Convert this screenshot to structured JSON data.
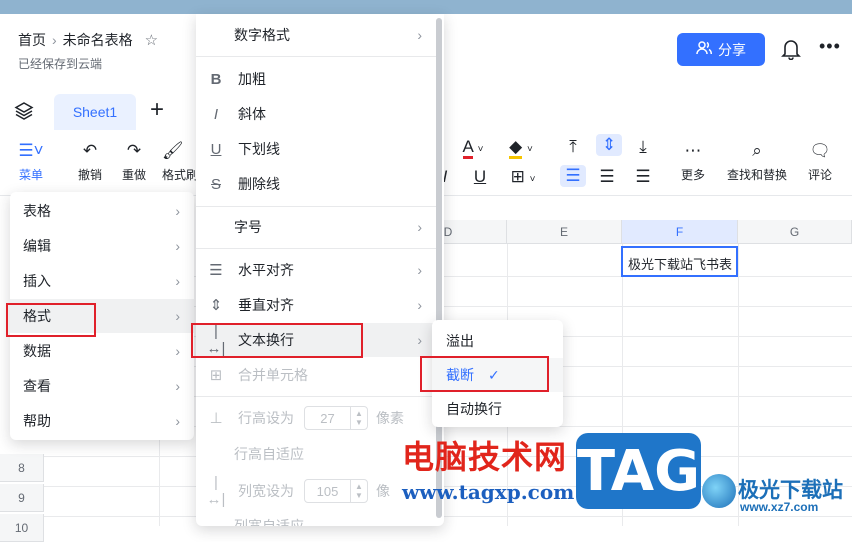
{
  "header": {
    "breadcrumb_home": "首页",
    "breadcrumb_sep": "›",
    "doc_title": "未命名表格",
    "saved_status": "已经保存到云端",
    "share_label": "分享"
  },
  "tabs": {
    "sheet1": "Sheet1",
    "add": "+"
  },
  "toolbar": {
    "menu": "菜单",
    "undo": "撤销",
    "redo": "重做",
    "format_painter": "格式刷",
    "more": "更多",
    "find_replace": "查找和替换",
    "comment": "评论"
  },
  "grid": {
    "columns": [
      "D",
      "E",
      "F",
      "G"
    ],
    "rows": [
      "8",
      "9",
      "10"
    ],
    "cell_f": "极光下载站飞书表"
  },
  "menu_main": {
    "items": [
      "表格",
      "编辑",
      "插入",
      "格式",
      "数据",
      "查看",
      "帮助"
    ]
  },
  "menu_format": {
    "number_format": "数字格式",
    "bold": "加粗",
    "italic": "斜体",
    "underline": "下划线",
    "strikethrough": "删除线",
    "font_size": "字号",
    "h_align": "水平对齐",
    "v_align": "垂直对齐",
    "text_wrap": "文本换行",
    "merge_cells": "合并单元格",
    "row_height_label": "行高设为",
    "row_height_value": "27",
    "row_height_unit": "像素",
    "row_height_auto": "行高自适应",
    "col_width_label": "列宽设为",
    "col_width_value": "105",
    "col_width_unit": "像",
    "col_width_auto": "列宽自适应"
  },
  "menu_wrap": {
    "overflow": "溢出",
    "clip": "截断",
    "auto_wrap": "自动换行",
    "check": "✓"
  },
  "watermark": {
    "site_cn": "电脑技术网",
    "site_url": "www.tagxp.com",
    "tag": "TAG",
    "brand": "极光下载站",
    "brand_url": "www.xz7.com"
  },
  "colors": {
    "accent": "#3370ff",
    "highlight": "#e0202a"
  }
}
